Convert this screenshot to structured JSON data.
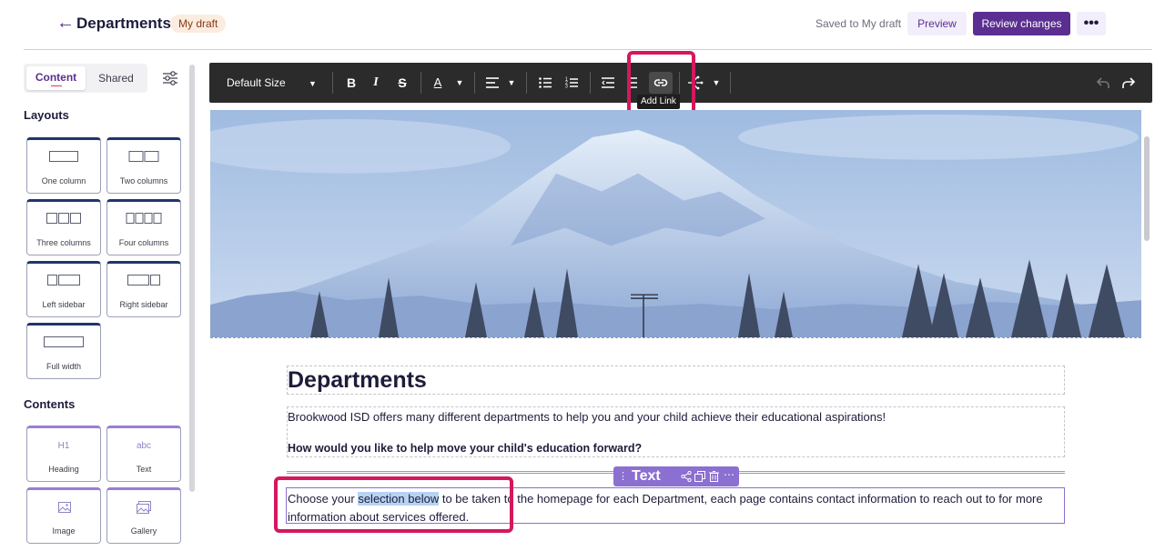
{
  "header": {
    "back_icon": "arrow-left-icon",
    "title": "Departments",
    "badge": "My draft",
    "saved_status": "Saved to My draft",
    "preview_label": "Preview",
    "review_label": "Review changes",
    "more_label": "•••"
  },
  "sidebar": {
    "tab_content": "Content",
    "tab_shared": "Shared",
    "layouts_heading": "Layouts",
    "layouts": [
      {
        "label": "One column"
      },
      {
        "label": "Two columns"
      },
      {
        "label": "Three columns"
      },
      {
        "label": "Four columns"
      },
      {
        "label": "Left sidebar"
      },
      {
        "label": "Right sidebar"
      },
      {
        "label": "Full width"
      }
    ],
    "contents_heading": "Contents",
    "contents": [
      {
        "label": "Heading",
        "glyph": "H1"
      },
      {
        "label": "Text",
        "glyph": "abc"
      },
      {
        "label": "Image",
        "icon": "image-icon"
      },
      {
        "label": "Gallery",
        "icon": "gallery-icon"
      }
    ]
  },
  "toolbar": {
    "font_size": "Default Size",
    "bold": "B",
    "italic": "I",
    "strike": "S",
    "text_color": "A",
    "tooltip": "Add Link"
  },
  "page": {
    "heading": "Departments",
    "intro": "Brookwood ISD offers many different departments to help you and your child achieve their educational aspirations!",
    "question": "How would you like to help move your child's education forward?",
    "block_label": "Text",
    "body_before": "Choose your ",
    "body_selected": "selection below",
    "body_after": " to be taken to the homepage for each Department, each page contains contact information to reach out to for more information about services offered."
  },
  "colors": {
    "brand_purple": "#5b2e91",
    "highlight": "#d6175d",
    "block_purple": "#8b6fd1"
  }
}
